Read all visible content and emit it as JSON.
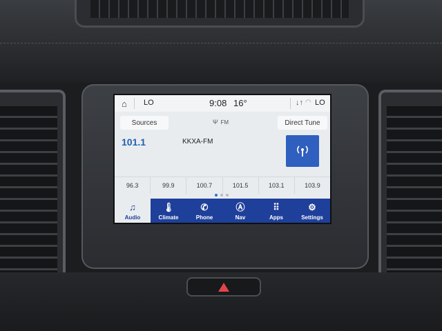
{
  "status": {
    "left_label": "LO",
    "time": "9:08",
    "temperature": "16°",
    "right_label": "LO"
  },
  "radio": {
    "sources_label": "Sources",
    "band": "FM",
    "direct_tune_label": "Direct Tune",
    "frequency": "101.1",
    "station": "KKXA-FM",
    "presets": [
      "96.3",
      "99.9",
      "100.7",
      "101.5",
      "103.1",
      "103.9"
    ],
    "page_count": 3,
    "current_page": 1
  },
  "nav": [
    {
      "label": "Audio",
      "icon": "music-note-icon",
      "active": true
    },
    {
      "label": "Climate",
      "icon": "thermometer-icon",
      "active": false
    },
    {
      "label": "Phone",
      "icon": "phone-icon",
      "active": false
    },
    {
      "label": "Nav",
      "icon": "navigation-icon",
      "active": false
    },
    {
      "label": "Apps",
      "icon": "apps-grid-icon",
      "active": false
    },
    {
      "label": "Settings",
      "icon": "gear-icon",
      "active": false
    }
  ],
  "colors": {
    "accent": "#1e3f9a",
    "frequency_blue": "#1f5fb0",
    "hazard_red": "#e0454a"
  }
}
